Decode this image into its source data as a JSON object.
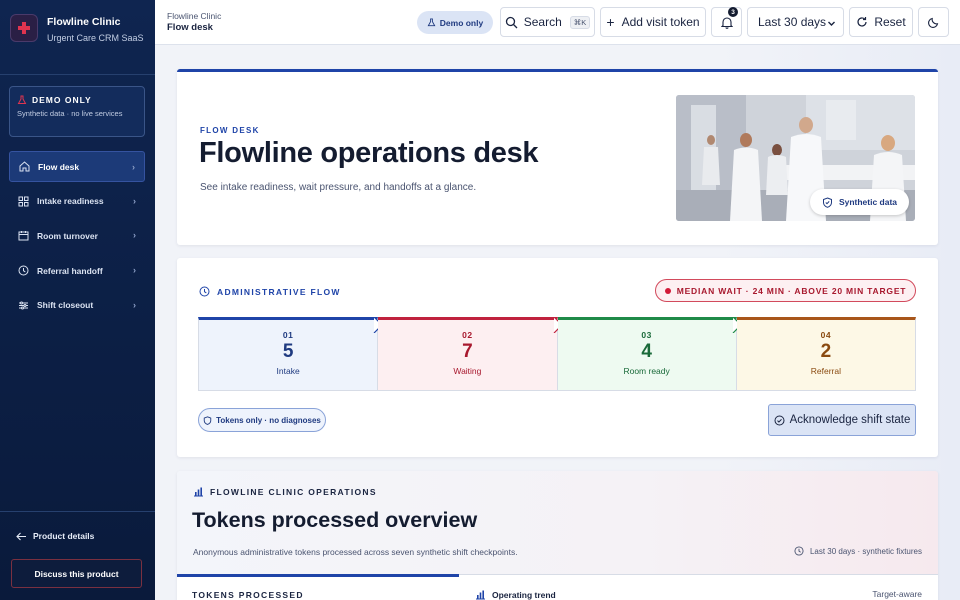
{
  "brand": {
    "name": "Flowline Clinic",
    "subtitle": "Urgent Care CRM SaaS"
  },
  "demo_card": {
    "title": "DEMO ONLY",
    "subtitle": "Synthetic data · no live services"
  },
  "sidebar": {
    "items": [
      {
        "label": "Flow desk",
        "icon": "home-icon",
        "active": true
      },
      {
        "label": "Intake readiness",
        "icon": "grid-icon"
      },
      {
        "label": "Room turnover",
        "icon": "calendar-icon"
      },
      {
        "label": "Referral handoff",
        "icon": "clock-icon"
      },
      {
        "label": "Shift closeout",
        "icon": "sliders-icon"
      }
    ],
    "product_details": "Product details",
    "discuss": "Discuss this product"
  },
  "topbar": {
    "crumb_parent": "Flowline Clinic",
    "crumb_current": "Flow desk",
    "demo_pill": "Demo only",
    "search_label": "Search",
    "search_kbd": "⌘K",
    "add_token": "Add visit token",
    "notifications_count": "3",
    "range_selected": "Last 30 days",
    "reset": "Reset"
  },
  "hero": {
    "eyebrow": "FLOW DESK",
    "title": "Flowline operations desk",
    "subtitle": "See intake readiness, wait pressure, and handoffs at a glance.",
    "photo_chip": "Synthetic data"
  },
  "flow": {
    "heading": "ADMINISTRATIVE FLOW",
    "wait_alert": "MEDIAN WAIT · 24 MIN · ABOVE 20 MIN TARGET",
    "stages": [
      {
        "num": "01",
        "value": "5",
        "label": "Intake",
        "color": "#1f44a8",
        "bg": "#eef3fc",
        "text": "#1f3a80"
      },
      {
        "num": "02",
        "value": "7",
        "label": "Waiting",
        "color": "#c0223e",
        "bg": "#fdeff1",
        "text": "#a8182e"
      },
      {
        "num": "03",
        "value": "4",
        "label": "Room ready",
        "color": "#1f8a48",
        "bg": "#eefaf1",
        "text": "#1a6a3a"
      },
      {
        "num": "04",
        "value": "2",
        "label": "Referral",
        "color": "#a8561a",
        "bg": "#fdf8e6",
        "text": "#8a4a10"
      }
    ],
    "tokens_pill": "Tokens only · no diagnoses",
    "acknowledge": "Acknowledge shift state"
  },
  "ops": {
    "eyebrow": "FLOWLINE CLINIC OPERATIONS",
    "title": "Tokens processed overview",
    "subtitle": "Anonymous administrative tokens processed across seven synthetic shift checkpoints.",
    "range": "Last 30 days · synthetic fixtures",
    "left_label": "TOKENS PROCESSED",
    "trend_label": "Operating trend",
    "aware_label": "Target-aware"
  }
}
